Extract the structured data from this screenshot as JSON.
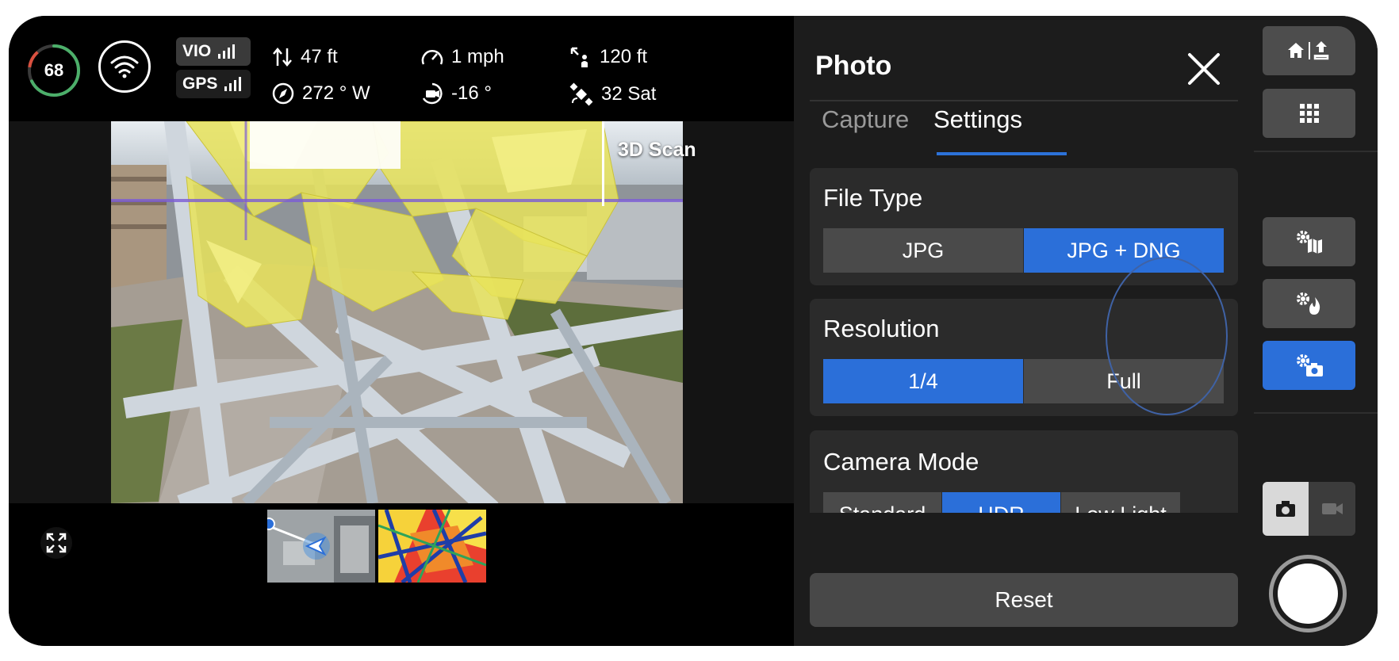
{
  "telemetry": {
    "battery_percent": "68",
    "vio_label": "VIO",
    "gps_label": "GPS",
    "altitude": "47 ft",
    "speed": "1 mph",
    "distance": "120 ft",
    "heading": "272 ° W",
    "gimbal_pitch": "-16 °",
    "satellites": "32 Sat"
  },
  "camera": {
    "overlay_label": "3D Scan"
  },
  "panel": {
    "title": "Photo",
    "tabs": [
      {
        "label": "Capture",
        "active": false
      },
      {
        "label": "Settings",
        "active": true
      }
    ],
    "file_type": {
      "title": "File Type",
      "options": [
        "JPG",
        "JPG + DNG"
      ],
      "selected": "JPG + DNG"
    },
    "resolution": {
      "title": "Resolution",
      "options": [
        "1/4",
        "Full"
      ],
      "selected": "1/4"
    },
    "camera_mode": {
      "title": "Camera Mode",
      "options": [
        "Standard",
        "HDR",
        "Low Light"
      ],
      "selected": "HDR"
    },
    "reset_label": "Reset"
  },
  "colors": {
    "accent": "#2b6fd9",
    "battery_ring": "#4caf6a"
  },
  "icons": {
    "home_upload": "home-upload-icon",
    "grid": "grid-icon",
    "map_settings": "gear-map-icon",
    "thermal_settings": "gear-flame-icon",
    "camera_settings": "gear-camera-icon",
    "photo_mode": "camera-icon",
    "video_mode": "video-icon"
  }
}
